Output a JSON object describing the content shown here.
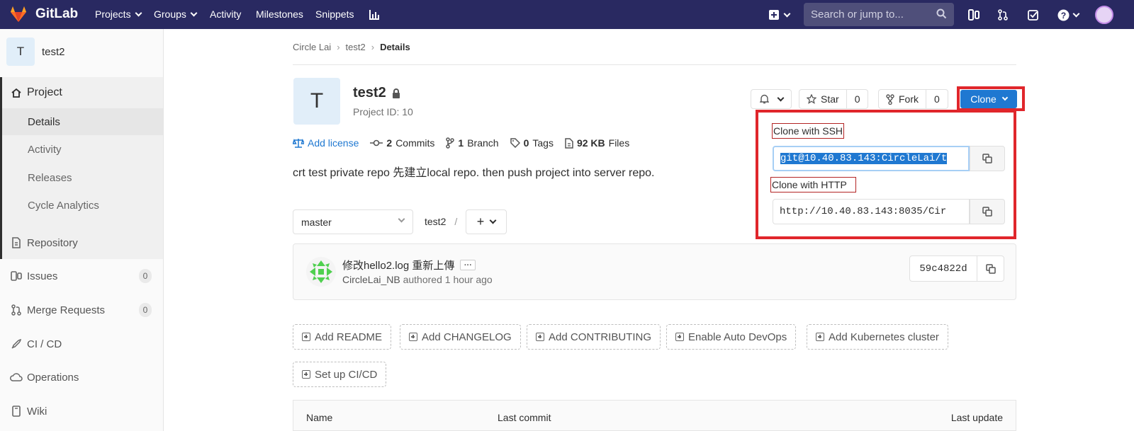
{
  "navbar": {
    "brand": "GitLab",
    "items": [
      {
        "label": "Projects",
        "has_dropdown": true
      },
      {
        "label": "Groups",
        "has_dropdown": true
      },
      {
        "label": "Activity"
      },
      {
        "label": "Milestones"
      },
      {
        "label": "Snippets"
      }
    ],
    "search_placeholder": "Search or jump to...",
    "colors": {
      "background": "#292961",
      "accent": "#1f78d1",
      "highlight": "#e0262b"
    }
  },
  "sidebar": {
    "project_initial": "T",
    "project_name": "test2",
    "section_title": "Project",
    "sub_items": [
      "Details",
      "Activity",
      "Releases",
      "Cycle Analytics"
    ],
    "items": [
      {
        "label": "Repository",
        "icon": "doc-icon"
      },
      {
        "label": "Issues",
        "icon": "issues-icon",
        "count": "0"
      },
      {
        "label": "Merge Requests",
        "icon": "merge-request-icon",
        "count": "0"
      },
      {
        "label": "CI / CD",
        "icon": "rocket-icon"
      },
      {
        "label": "Operations",
        "icon": "cloud-icon"
      },
      {
        "label": "Wiki",
        "icon": "book-icon"
      }
    ]
  },
  "breadcrumb": [
    "Circle Lai",
    "test2",
    "Details"
  ],
  "project": {
    "initial": "T",
    "name": "test2",
    "id_text": "Project ID: 10",
    "stats": {
      "license": "Add license",
      "commits_num": "2",
      "commits_label": "Commits",
      "branch_num": "1",
      "branch_label": "Branch",
      "tags_num": "0",
      "tags_label": "Tags",
      "files_size": "92 KB",
      "files_label": "Files"
    },
    "description": "crt test private repo 先建立local repo. then push project into server repo."
  },
  "actions": {
    "star_label": "Star",
    "star_count": "0",
    "fork_label": "Fork",
    "fork_count": "0",
    "clone_label": "Clone"
  },
  "clone_panel": {
    "ssh_label": "Clone with SSH",
    "ssh_url": "git@10.40.83.143:CircleLai/t",
    "http_label": "Clone with HTTP",
    "http_url": "http://10.40.83.143:8035/Cir"
  },
  "repo": {
    "branch": "master",
    "path": "test2",
    "path_sep": "/",
    "add_symbol": "+"
  },
  "commit": {
    "message": "修改hello2.log 重新上傳",
    "author": "CircleLai_NB",
    "authored": "authored",
    "time": "1 hour ago",
    "sha": "59c4822d"
  },
  "quick_actions": [
    "Add README",
    "Add CHANGELOG",
    "Add CONTRIBUTING",
    "Enable Auto DevOps",
    "Add Kubernetes cluster",
    "Set up CI/CD"
  ],
  "table": {
    "headers": [
      "Name",
      "Last commit",
      "Last update"
    ]
  }
}
